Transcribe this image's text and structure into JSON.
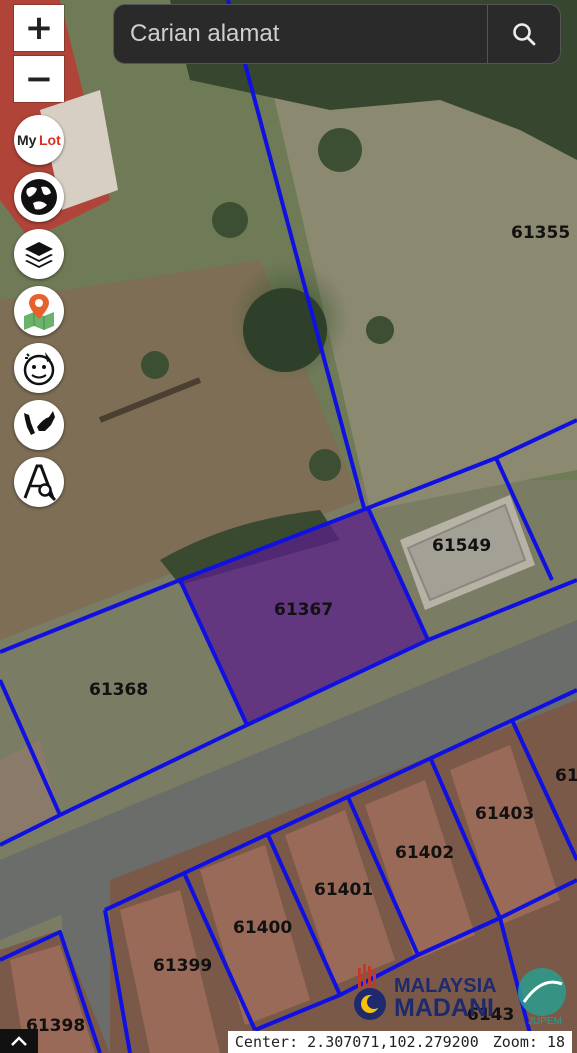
{
  "search": {
    "placeholder": "Carian alamat"
  },
  "controls": {
    "zoom_in": "+",
    "zoom_out": "−",
    "mylot_text": "MyLot",
    "tools": [
      "mylot-icon",
      "globe-icon",
      "layers-icon",
      "map-pin-icon",
      "clear-icon",
      "malaysia-map-icon",
      "measure-search-icon"
    ]
  },
  "lots": {
    "l61355": "61355",
    "l61549": "61549",
    "l61367": "61367",
    "l61368": "61368",
    "l61403": "61403",
    "l61402": "61402",
    "l61401": "61401",
    "l61400": "61400",
    "l61399": "61399",
    "l61398": "61398",
    "l614xx": "61",
    "l6143x": "6143"
  },
  "branding": {
    "line1": "MALAYSIA",
    "line2": "MADANI",
    "jupem": "JUPEM"
  },
  "status": {
    "center": "Center: 2.307071,102.279200",
    "zoom": "Zoom: 18"
  },
  "colors": {
    "boundary": "#1010e0",
    "selected_fill": "#5a1d8c"
  }
}
